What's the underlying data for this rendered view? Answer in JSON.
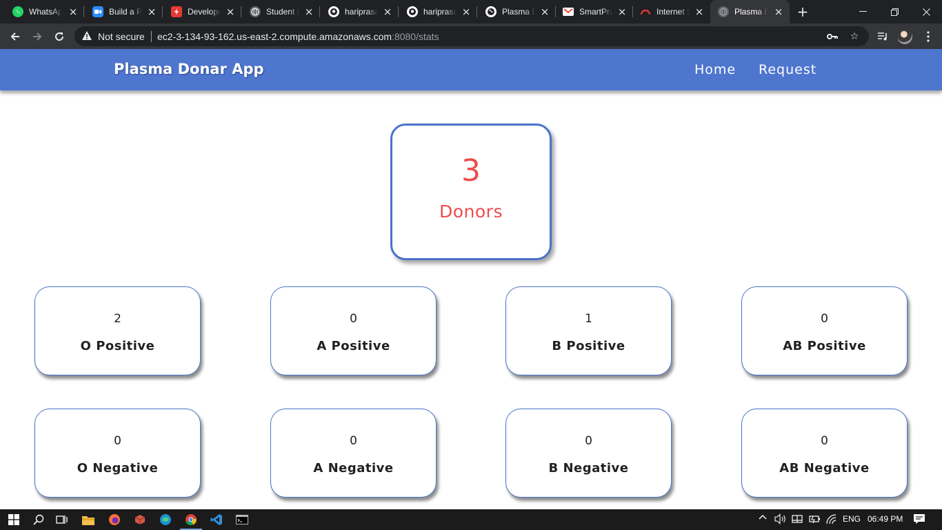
{
  "browser": {
    "tabs": [
      {
        "title": "WhatsApp",
        "icon": "whatsapp-icon",
        "color": "#25d366"
      },
      {
        "title": "Build a Plasma",
        "icon": "zoom-icon",
        "color": "#2d8cff"
      },
      {
        "title": "Developer",
        "icon": "developer-icon",
        "color": "#e53935"
      },
      {
        "title": "Student D",
        "icon": "globe-icon",
        "color": "#9aa0a6"
      },
      {
        "title": "hariprasad",
        "icon": "github-icon",
        "color": "#ffffff"
      },
      {
        "title": "hariprasad",
        "icon": "github-icon",
        "color": "#ffffff"
      },
      {
        "title": "Plasma D",
        "icon": "globe-icon",
        "color": "#ffffff"
      },
      {
        "title": "SmartPra",
        "icon": "gmail-icon",
        "color": "#ea4335"
      },
      {
        "title": "Internet S",
        "icon": "speedtest-icon",
        "color": "#e53935"
      },
      {
        "title": "Plasma D",
        "icon": "globe-icon",
        "color": "#9aa0a6",
        "active": true
      }
    ],
    "security_label": "Not secure",
    "url_host": "ec2-3-134-93-162.us-east-2.compute.amazonaws.com",
    "url_rest": ":8080/stats"
  },
  "app": {
    "brand": "Plasma Donar App",
    "nav": {
      "home": "Home",
      "request": "Request"
    },
    "total": {
      "count": "3",
      "label": "Donors"
    },
    "groups": [
      {
        "count": "2",
        "label": "O Positive"
      },
      {
        "count": "0",
        "label": "A Positive"
      },
      {
        "count": "1",
        "label": "B Positive"
      },
      {
        "count": "0",
        "label": "AB Positive"
      },
      {
        "count": "0",
        "label": "O Negative"
      },
      {
        "count": "0",
        "label": "A Negative"
      },
      {
        "count": "0",
        "label": "B Negative"
      },
      {
        "count": "0",
        "label": "AB Negative"
      }
    ]
  },
  "taskbar": {
    "language": "ENG",
    "time": "06:49 PM"
  },
  "colors": {
    "accent": "#4e76cf",
    "donor_red": "#ef4c4c"
  }
}
